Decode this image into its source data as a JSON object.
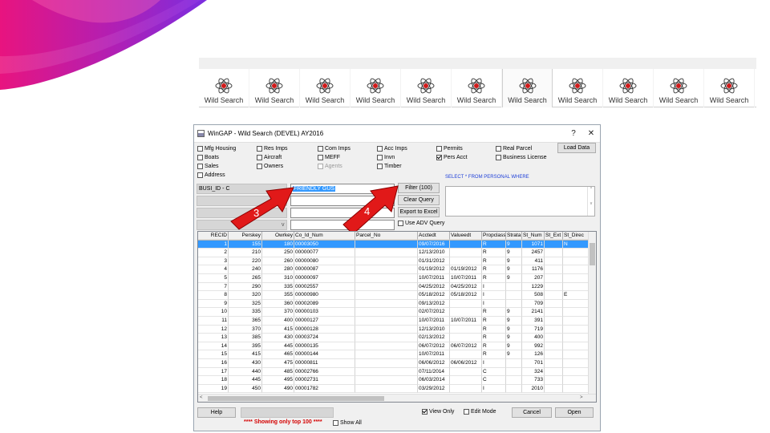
{
  "colors": {
    "swoosh_magenta": "#e8147f",
    "swoosh_purple": "#8e2bd6",
    "selection": "#3399ff",
    "arrow_red": "#e11919",
    "sql_blue": "#1d3ed8",
    "showing_red": "#d40000"
  },
  "toolbar": {
    "buttons": [
      {
        "label": "Wild Search",
        "icon": "atom-icon"
      },
      {
        "label": "Wild Search",
        "icon": "atom-icon"
      },
      {
        "label": "Wild Search",
        "icon": "atom-icon"
      },
      {
        "label": "Wild Search",
        "icon": "atom-icon"
      },
      {
        "label": "Wild Search",
        "icon": "atom-icon"
      },
      {
        "label": "Wild Search",
        "icon": "atom-icon"
      },
      {
        "label": "Wild Search",
        "icon": "atom-icon",
        "active": true
      },
      {
        "label": "Wild Search",
        "icon": "atom-icon"
      },
      {
        "label": "Wild Search",
        "icon": "atom-icon"
      },
      {
        "label": "Wild Search",
        "icon": "atom-icon"
      },
      {
        "label": "Wild Search",
        "icon": "atom-icon"
      }
    ]
  },
  "dialog": {
    "title": "WinGAP - Wild Search (DEVEL) AY2016",
    "help_glyph": "?",
    "close_glyph": "✕",
    "checkboxes": {
      "mfg_housing": {
        "label": "Mfg Housing",
        "checked": false
      },
      "boats": {
        "label": "Boats",
        "checked": false
      },
      "sales": {
        "label": "Sales",
        "checked": false
      },
      "address": {
        "label": "Address",
        "checked": false
      },
      "res_imps": {
        "label": "Res Imps",
        "checked": false
      },
      "aircraft": {
        "label": "Aircraft",
        "checked": false
      },
      "owners": {
        "label": "Owners",
        "checked": false
      },
      "com_imps": {
        "label": "Com Imps",
        "checked": false
      },
      "meff": {
        "label": "MEFF",
        "checked": false
      },
      "agents": {
        "label": "Agents",
        "checked": false,
        "disabled": true
      },
      "acc_imps": {
        "label": "Acc Imps",
        "checked": false
      },
      "invn": {
        "label": "Invn",
        "checked": false
      },
      "timber": {
        "label": "Timber",
        "checked": false
      },
      "permits": {
        "label": "Permits",
        "checked": false
      },
      "pers_acct": {
        "label": "Pers Acct",
        "checked": true
      },
      "real_parcel": {
        "label": "Real Parcel",
        "checked": false
      },
      "business_license": {
        "label": "Business License",
        "checked": false
      },
      "use_adv_query": {
        "label": "Use ADV Query",
        "checked": false
      },
      "view_only": {
        "label": "View Only",
        "checked": true
      },
      "edit_mode": {
        "label": "Edit Mode",
        "checked": false
      },
      "show_all": {
        "label": "Show All",
        "checked": false
      }
    },
    "buttons": {
      "load_data": "Load Data",
      "filter": "Filter (100)",
      "clear_query": "Clear Query",
      "export": "Export to Excel",
      "help": "Help",
      "cancel": "Cancel",
      "open": "Open"
    },
    "sql_label": "SELECT * FROM PERSONAL WHERE",
    "sql_scroll_up": "^",
    "sql_scroll_down": "v",
    "filter_field": "BUSI_ID - C",
    "filter_value": "FRIENDLY GUS",
    "combo_arrow": "v",
    "showing_text": "**** Showing only top 100 ****",
    "annotations": {
      "arrow_3": "3",
      "arrow_4": "4"
    }
  },
  "grid": {
    "columns": [
      "RECID",
      "Perskey",
      "Owrkey",
      "Co_Id_Num",
      "Parcel_No",
      "Acctedt",
      "Valueedt",
      "Propclass",
      "Strata",
      "St_Num",
      "St_Ext",
      "St_Direc"
    ],
    "rows": [
      [
        "1",
        "155",
        "180",
        "00003050",
        "",
        "09/07/2016",
        "",
        "R",
        "9",
        "1071",
        "",
        "N"
      ],
      [
        "2",
        "210",
        "250",
        "00000077",
        "",
        "12/13/2010",
        "",
        "R",
        "9",
        "2457",
        "",
        ""
      ],
      [
        "3",
        "220",
        "260",
        "00000080",
        "",
        "01/31/2012",
        "",
        "R",
        "9",
        "411",
        "",
        ""
      ],
      [
        "4",
        "240",
        "280",
        "00000087",
        "",
        "01/19/2012",
        "01/19/2012",
        "R",
        "9",
        "1176",
        "",
        ""
      ],
      [
        "5",
        "265",
        "310",
        "00000097",
        "",
        "10/07/2011",
        "10/07/2011",
        "R",
        "9",
        "207",
        "",
        ""
      ],
      [
        "7",
        "290",
        "335",
        "00002557",
        "",
        "04/25/2012",
        "04/25/2012",
        "I",
        "",
        "1229",
        "",
        ""
      ],
      [
        "8",
        "320",
        "355",
        "00000980",
        "",
        "05/18/2012",
        "05/18/2012",
        "I",
        "",
        "508",
        "",
        "E"
      ],
      [
        "9",
        "325",
        "360",
        "00002089",
        "",
        "09/13/2012",
        "",
        "I",
        "",
        "709",
        "",
        ""
      ],
      [
        "10",
        "335",
        "370",
        "00000103",
        "",
        "02/07/2012",
        "",
        "R",
        "9",
        "2141",
        "",
        ""
      ],
      [
        "11",
        "365",
        "400",
        "00000127",
        "",
        "10/07/2011",
        "10/07/2011",
        "R",
        "9",
        "391",
        "",
        ""
      ],
      [
        "12",
        "370",
        "415",
        "00000128",
        "",
        "12/13/2010",
        "",
        "R",
        "9",
        "719",
        "",
        ""
      ],
      [
        "13",
        "385",
        "430",
        "00003724",
        "",
        "02/13/2012",
        "",
        "R",
        "9",
        "400",
        "",
        ""
      ],
      [
        "14",
        "395",
        "445",
        "00000135",
        "",
        "06/07/2012",
        "06/07/2012",
        "R",
        "9",
        "992",
        "",
        ""
      ],
      [
        "15",
        "415",
        "465",
        "00000144",
        "",
        "10/07/2011",
        "",
        "R",
        "9",
        "126",
        "",
        ""
      ],
      [
        "16",
        "430",
        "475",
        "00000811",
        "",
        "06/06/2012",
        "06/06/2012",
        "I",
        "",
        "701",
        "",
        ""
      ],
      [
        "17",
        "440",
        "485",
        "00002766",
        "",
        "07/11/2014",
        "",
        "C",
        "",
        "324",
        "",
        ""
      ],
      [
        "18",
        "445",
        "495",
        "00002731",
        "",
        "06/03/2014",
        "",
        "C",
        "",
        "733",
        "",
        ""
      ],
      [
        "19",
        "450",
        "490",
        "00001782",
        "",
        "03/29/2012",
        "",
        "I",
        "",
        "2010",
        "",
        ""
      ]
    ],
    "selected_row": 0,
    "scroll_left": "<",
    "scroll_right": ">"
  }
}
